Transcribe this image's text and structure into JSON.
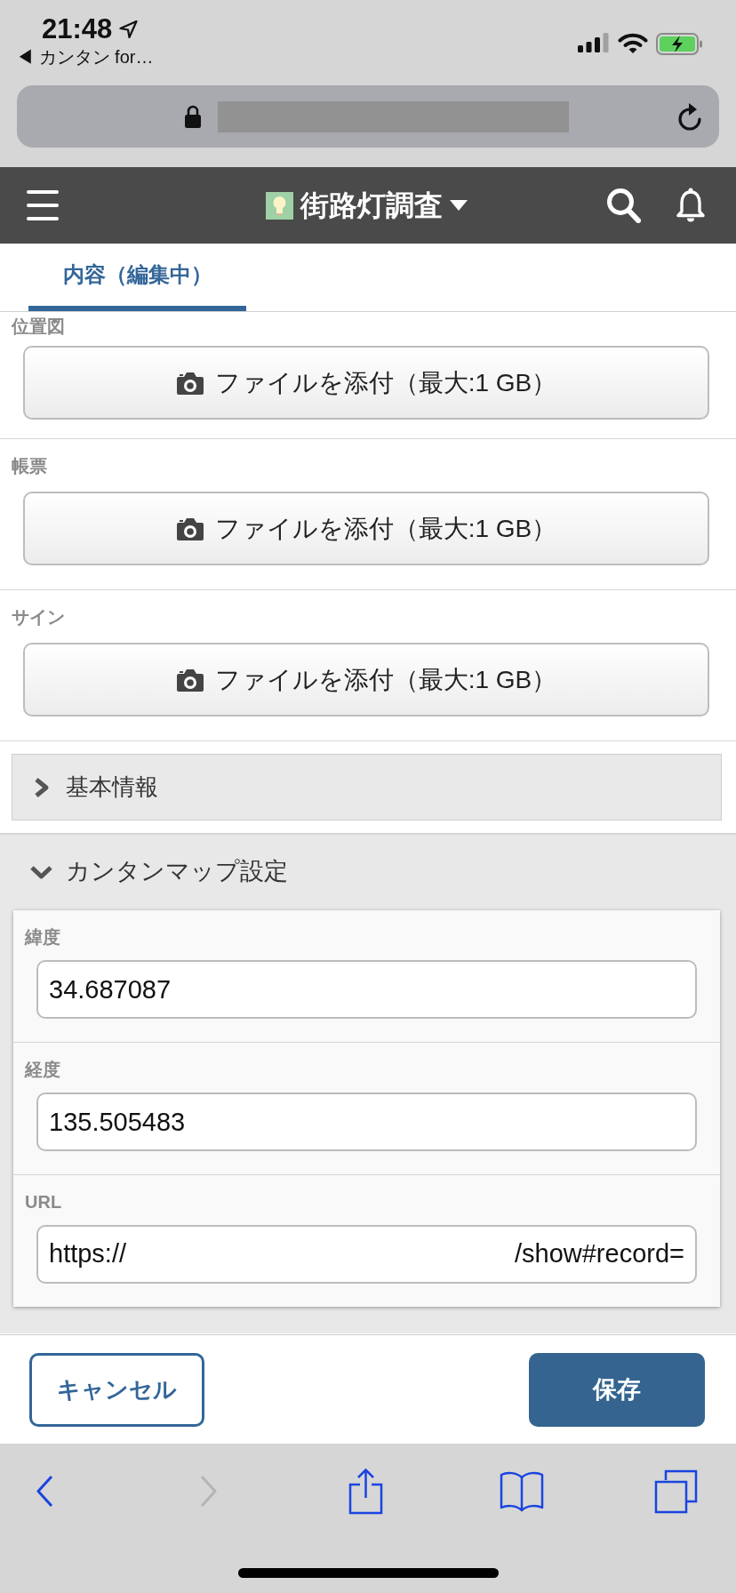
{
  "status_bar": {
    "time": "21:48",
    "back_link": "◀ カンタン for…"
  },
  "header": {
    "title": "街路灯調査"
  },
  "tabs": [
    {
      "label": "内容（編集中）",
      "selected": true
    }
  ],
  "attachment_fields": [
    {
      "label": "位置図",
      "button": "ファイルを添付（最大:1 GB）"
    },
    {
      "label": "帳票",
      "button": "ファイルを添付（最大:1 GB）"
    },
    {
      "label": "サイン",
      "button": "ファイルを添付（最大:1 GB）"
    }
  ],
  "sections": [
    {
      "title": "基本情報",
      "expanded": false
    },
    {
      "title": "カンタンマップ設定",
      "expanded": true,
      "fields": [
        {
          "kind": "text",
          "label": "緯度",
          "value": "34.687087"
        },
        {
          "kind": "text",
          "label": "経度",
          "value": "135.505483"
        },
        {
          "kind": "url",
          "label": "URL",
          "value_start": "https://",
          "value_end": "/show#record="
        }
      ]
    }
  ],
  "actions": {
    "cancel": "キャンセル",
    "save": "保存"
  },
  "browser_toolbar": [
    {
      "kind": "back",
      "disabled": false
    },
    {
      "kind": "forward",
      "disabled": true
    },
    {
      "kind": "share",
      "disabled": false
    },
    {
      "kind": "bookmarks",
      "disabled": false
    },
    {
      "kind": "tabs",
      "disabled": false
    }
  ]
}
